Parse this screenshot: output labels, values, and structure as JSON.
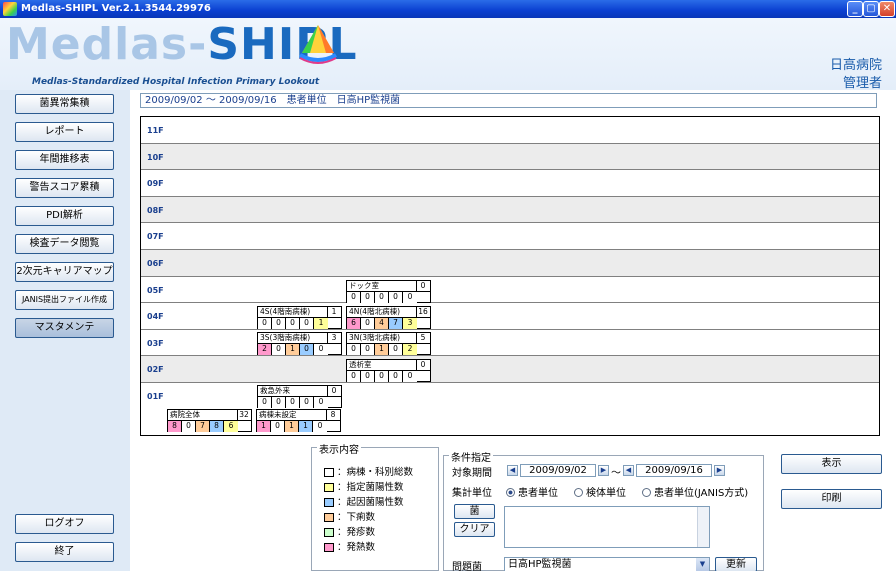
{
  "window": {
    "title": "Medlas-SHIPL  Ver.2.1.3544.29976",
    "min": "_",
    "max": "▢",
    "close": "✕"
  },
  "header": {
    "logo_prefix": "Medlas-",
    "logo_main": "SHIPL",
    "logo_sub": "Medlas-Standardized Hospital Infection Primary Lookout",
    "hospital": "日高病院",
    "user": "管理者"
  },
  "sidebar": {
    "items": [
      {
        "label": "菌異常集積"
      },
      {
        "label": "レポート"
      },
      {
        "label": "年間推移表"
      },
      {
        "label": "警告スコア累積"
      },
      {
        "label": "PDI解析"
      },
      {
        "label": "検査データ閲覧"
      },
      {
        "label": "2次元キャリアマップ"
      },
      {
        "label": "JANIS提出ファイル作成"
      },
      {
        "label": "マスタメンテ"
      }
    ],
    "logoff": "ログオフ",
    "exit": "終了"
  },
  "info_bar": "2009/09/02 ～ 2009/09/16　患者単位　日高HP監視菌",
  "floors": [
    "11F",
    "10F",
    "09F",
    "08F",
    "07F",
    "06F",
    "05F",
    "04F",
    "03F",
    "02F",
    "01F"
  ],
  "wards": [
    {
      "name": "ドック室",
      "total": "0",
      "cells": [
        "0",
        "0",
        "0",
        "0",
        "0"
      ]
    },
    {
      "name": "4S(4階南病棟)",
      "total": "1",
      "cells": [
        "0",
        "0",
        "0",
        "0",
        "1"
      ]
    },
    {
      "name": "4N(4階北病棟)",
      "total": "16",
      "cells": [
        "6",
        "0",
        "4",
        "7",
        "3"
      ]
    },
    {
      "name": "3S(3階南病棟)",
      "total": "3",
      "cells": [
        "2",
        "0",
        "1",
        "0",
        "0"
      ]
    },
    {
      "name": "3N(3階北病棟)",
      "total": "5",
      "cells": [
        "0",
        "0",
        "1",
        "0",
        "2"
      ]
    },
    {
      "name": "透析室",
      "total": "0",
      "cells": [
        "0",
        "0",
        "0",
        "0",
        "0"
      ]
    },
    {
      "name": "救急外来",
      "total": "0",
      "cells": [
        "0",
        "0",
        "0",
        "0",
        "0"
      ]
    },
    {
      "name": "病院全体",
      "total": "32",
      "cells": [
        "8",
        "0",
        "7",
        "8",
        "6"
      ]
    },
    {
      "name": "病棟未設定",
      "total": "8",
      "cells": [
        "1",
        "0",
        "1",
        "1",
        "0"
      ]
    }
  ],
  "legend": {
    "title": "表示内容",
    "items": [
      {
        "label": "：病棟・科別総数",
        "color": "#ffffff"
      },
      {
        "label": "：指定菌陽性数",
        "color": "#ffff99"
      },
      {
        "label": "：起因菌陽性数",
        "color": "#99ccff"
      },
      {
        "label": "：下痢数",
        "color": "#ffcc99"
      },
      {
        "label": "：発疹数",
        "color": "#ccffcc"
      },
      {
        "label": "：発熱数",
        "color": "#ff99cc"
      }
    ]
  },
  "conditions": {
    "title": "条件指定",
    "period_label": "対象期間",
    "date_from": "2009/09/02",
    "tilde": "～",
    "date_to": "2009/09/16",
    "unit_label": "集計単位",
    "unit_options": [
      "患者単位",
      "検体単位",
      "患者単位(JANIS方式)"
    ],
    "selected_unit": "患者単位",
    "bacteria_button": "菌",
    "clear_button": "クリア",
    "problem_label": "問題菌",
    "problem_value": "日高HP監視菌",
    "update_button": "更新"
  },
  "actions": {
    "display": "表示",
    "print": "印刷"
  }
}
